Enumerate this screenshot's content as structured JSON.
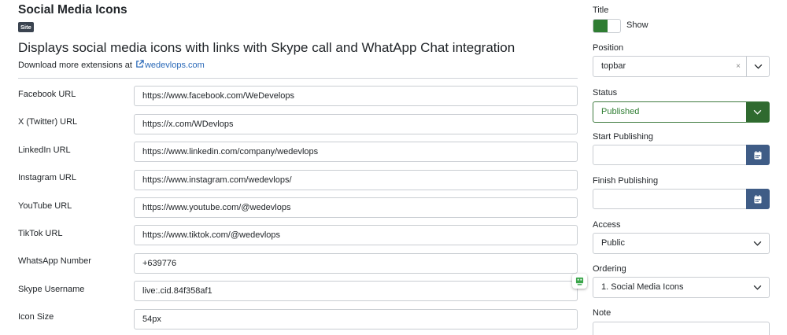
{
  "header": {
    "title": "Social Media Icons",
    "badge": "Site",
    "description": "Displays social media icons with links with Skype call and WhatApp Chat integration",
    "download_prefix": "Download more extensions at",
    "download_link": "wedevlops.com"
  },
  "fields": [
    {
      "label": "Facebook URL",
      "value": "https://www.facebook.com/WeDevelops"
    },
    {
      "label": "X (Twitter) URL",
      "value": "https://x.com/WDevlops"
    },
    {
      "label": "LinkedIn URL",
      "value": "https://www.linkedin.com/company/wedevlops"
    },
    {
      "label": "Instagram URL",
      "value": "https://www.instagram.com/wedevlops/"
    },
    {
      "label": "YouTube URL",
      "value": "https://www.youtube.com/@wedevlops"
    },
    {
      "label": "TikTok URL",
      "value": "https://www.tiktok.com/@wedevlops"
    },
    {
      "label": "WhatsApp Number",
      "value": "+639776"
    },
    {
      "label": "Skype Username",
      "value": "live:.cid.84f358af1"
    },
    {
      "label": "Icon Size",
      "value": "54px"
    }
  ],
  "sidebar": {
    "title_label": "Title",
    "title_toggle": "Show",
    "position_label": "Position",
    "position_value": "topbar",
    "position_clear": "×",
    "status_label": "Status",
    "status_value": "Published",
    "start_label": "Start Publishing",
    "start_value": "",
    "finish_label": "Finish Publishing",
    "finish_value": "",
    "access_label": "Access",
    "access_value": "Public",
    "ordering_label": "Ordering",
    "ordering_value": "1. Social Media Icons",
    "note_label": "Note",
    "note_value": ""
  },
  "icons": {
    "external_link": "external-link-icon",
    "calendar": "calendar-icon",
    "chevron": "chevron-down-icon",
    "assist": "form-assist-icon"
  },
  "colors": {
    "accent_green": "#2f7d32",
    "calendar_blue": "#3f5c86",
    "link_blue": "#2a69b8",
    "badge_dark": "#3b4450"
  }
}
